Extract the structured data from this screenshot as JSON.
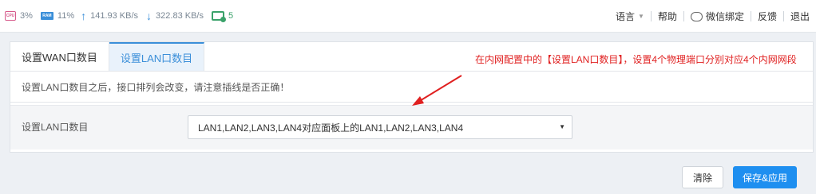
{
  "status": {
    "cpu_icon": "cpu-icon",
    "cpu": "3%",
    "ram_icon": "ram-icon",
    "ram": "11%",
    "upload": "141.93 KB/s",
    "download": "322.83 KB/s",
    "devices": "5"
  },
  "nav": {
    "language": "语言",
    "help": "帮助",
    "wechat": "微信绑定",
    "feedback": "反馈",
    "logout": "退出"
  },
  "tabs": [
    {
      "label": "设置WAN口数目",
      "active": false
    },
    {
      "label": "设置LAN口数目",
      "active": true
    }
  ],
  "notice": "设置LAN口数目之后，接口排列会改变，请注意插线是否正确！",
  "annotation": "在内网配置中的【设置LAN口数目】，设置4个物理端口分别对应4个内网网段",
  "form": {
    "label": "设置LAN口数目",
    "selected": "LAN1,LAN2,LAN3,LAN4对应面板上的LAN1,LAN2,LAN3,LAN4"
  },
  "buttons": {
    "clear": "清除",
    "save": "保存&应用"
  },
  "colors": {
    "accent": "#1e8ff0",
    "annotation": "#e02020"
  }
}
